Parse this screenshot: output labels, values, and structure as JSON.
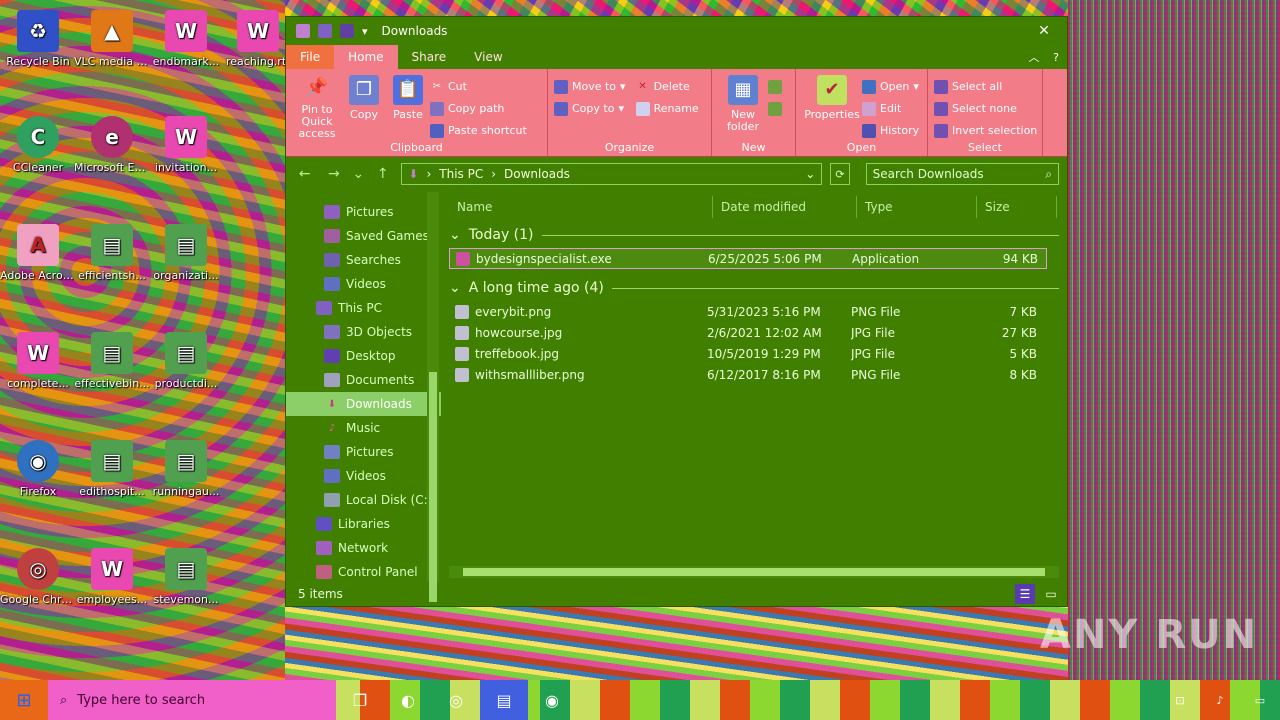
{
  "window": {
    "title": "Downloads",
    "tabs": [
      "File",
      "Home",
      "Share",
      "View"
    ]
  },
  "ribbon": {
    "clipboard": {
      "label": "Clipboard",
      "pin": "Pin to Quick access",
      "copy": "Copy",
      "paste": "Paste",
      "cut": "Cut",
      "copy_path": "Copy path",
      "paste_shortcut": "Paste shortcut"
    },
    "organize": {
      "label": "Organize",
      "move_to": "Move to",
      "copy_to": "Copy to",
      "delete": "Delete",
      "rename": "Rename"
    },
    "new": {
      "label": "New",
      "new_folder": "New folder"
    },
    "open": {
      "label": "Open",
      "properties": "Properties",
      "open": "Open",
      "edit": "Edit",
      "history": "History"
    },
    "select": {
      "label": "Select",
      "select_all": "Select all",
      "select_none": "Select none",
      "invert": "Invert selection"
    }
  },
  "address": {
    "crumbs": [
      "This PC",
      "Downloads"
    ],
    "search_placeholder": "Search Downloads"
  },
  "nav": {
    "items": [
      "Pictures",
      "Saved Games",
      "Searches",
      "Videos",
      "This PC",
      "3D Objects",
      "Desktop",
      "Documents",
      "Downloads",
      "Music",
      "Pictures",
      "Videos",
      "Local Disk (C:)",
      "Libraries",
      "Network",
      "Control Panel"
    ]
  },
  "columns": {
    "name": "Name",
    "date": "Date modified",
    "type": "Type",
    "size": "Size"
  },
  "groups": [
    {
      "header": "Today (1)",
      "files": [
        {
          "name": "bydesignspecialist.exe",
          "date": "6/25/2025 5:06 PM",
          "type": "Application",
          "size": "94 KB"
        }
      ]
    },
    {
      "header": "A long time ago (4)",
      "files": [
        {
          "name": "everybit.png",
          "date": "5/31/2023 5:16 PM",
          "type": "PNG File",
          "size": "7 KB"
        },
        {
          "name": "howcourse.jpg",
          "date": "2/6/2021 12:02 AM",
          "type": "JPG File",
          "size": "27 KB"
        },
        {
          "name": "treffebook.jpg",
          "date": "10/5/2019 1:29 PM",
          "type": "JPG File",
          "size": "5 KB"
        },
        {
          "name": "withsmallliber.png",
          "date": "6/12/2017 8:16 PM",
          "type": "PNG File",
          "size": "8 KB"
        }
      ]
    }
  ],
  "status": {
    "count": "5 items"
  },
  "desktop": {
    "icons": [
      "Recycle Bin",
      "VLC media player",
      "endbmark...",
      "reaching.rtf",
      "CCleaner",
      "Microsoft Edge",
      "invitation...",
      "Adobe Acrobat",
      "efficientsh...",
      "organizati...",
      "complete...",
      "effectivebin...",
      "productdi...",
      "Firefox",
      "edithospit...",
      "runningau...",
      "Google Chrome",
      "employees...",
      "stevemon..."
    ]
  },
  "taskbar": {
    "search_placeholder": "Type here to search"
  },
  "watermark": "ANY RUN"
}
